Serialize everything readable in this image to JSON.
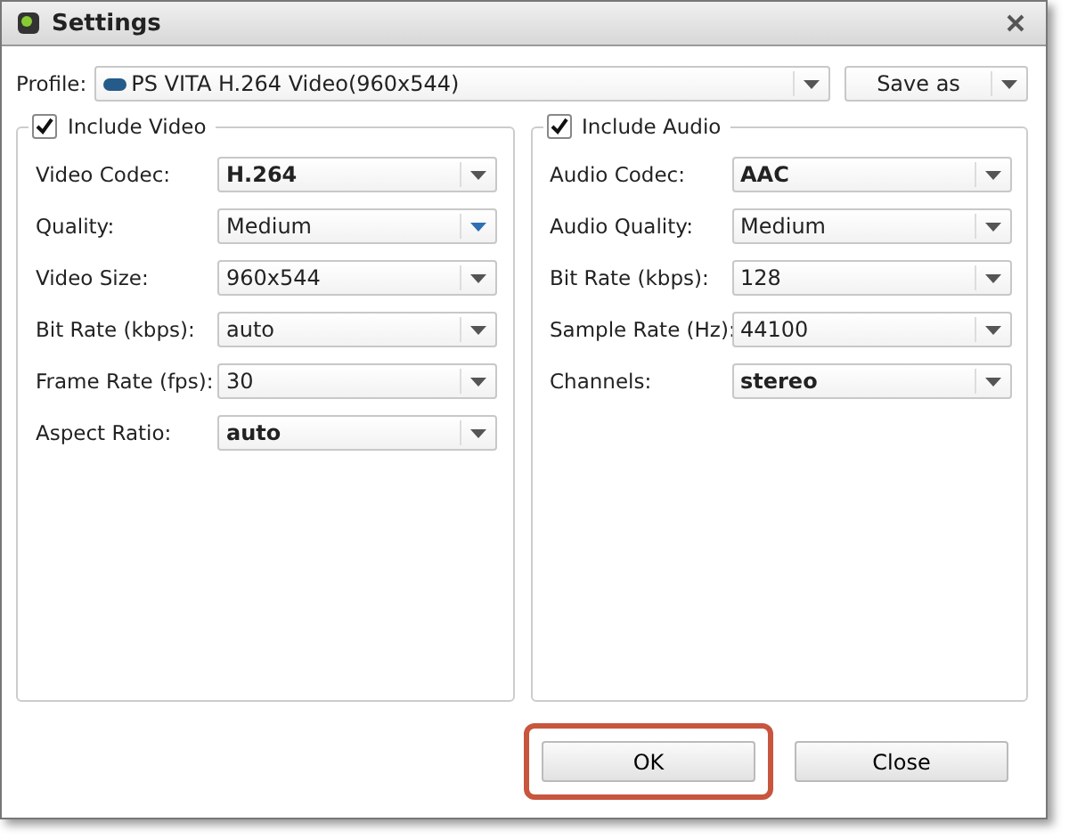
{
  "window": {
    "title": "Settings"
  },
  "profile": {
    "label": "Profile:",
    "value": "PS VITA H.264 Video(960x544)"
  },
  "save_as": {
    "label": "Save as"
  },
  "groups": [
    {
      "title": "Include Video",
      "checked": true,
      "fields": [
        {
          "label": "Video Codec:",
          "value": "H.264",
          "bold": true,
          "focused": false
        },
        {
          "label": "Quality:",
          "value": "Medium",
          "bold": false,
          "focused": true
        },
        {
          "label": "Video Size:",
          "value": "960x544",
          "bold": false,
          "focused": false
        },
        {
          "label": "Bit Rate (kbps):",
          "value": "auto",
          "bold": false,
          "focused": false
        },
        {
          "label": "Frame Rate (fps):",
          "value": "30",
          "bold": false,
          "focused": false
        },
        {
          "label": "Aspect Ratio:",
          "value": "auto",
          "bold": true,
          "focused": false
        }
      ]
    },
    {
      "title": "Include Audio",
      "checked": true,
      "fields": [
        {
          "label": "Audio Codec:",
          "value": "AAC",
          "bold": true,
          "focused": false
        },
        {
          "label": "Audio Quality:",
          "value": "Medium",
          "bold": false,
          "focused": false
        },
        {
          "label": "Bit Rate (kbps):",
          "value": "128",
          "bold": false,
          "focused": false
        },
        {
          "label": "Sample Rate (Hz):",
          "value": "44100",
          "bold": false,
          "focused": false
        },
        {
          "label": "Channels:",
          "value": "stereo",
          "bold": true,
          "focused": false
        }
      ]
    }
  ],
  "buttons": [
    {
      "label": "OK",
      "highlighted": true
    },
    {
      "label": "Close",
      "highlighted": false
    }
  ]
}
